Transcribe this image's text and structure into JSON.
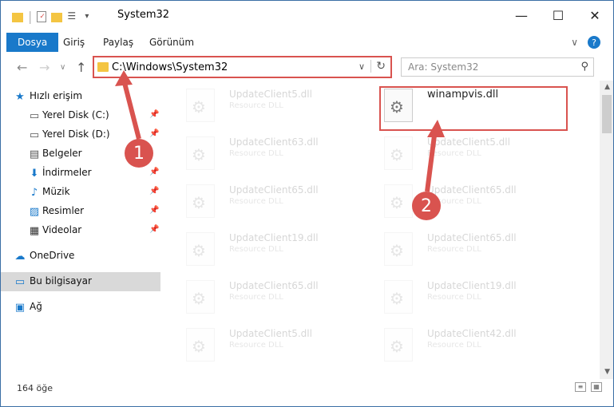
{
  "window": {
    "title": "System32",
    "accent_color": "#1979ca",
    "highlight_color": "#d9534f"
  },
  "ribbon": {
    "tabs": [
      {
        "label": "Dosya",
        "active": true
      },
      {
        "label": "Giriş",
        "active": false
      },
      {
        "label": "Paylaş",
        "active": false
      },
      {
        "label": "Görünüm",
        "active": false
      }
    ]
  },
  "address": {
    "path": "C:\\Windows\\System32",
    "search_placeholder": "Ara: System32"
  },
  "sidebar": {
    "quick_access_label": "Hızlı erişim",
    "items": [
      {
        "label": "Yerel Disk (C:)",
        "icon": "drive-icon",
        "pinned": true
      },
      {
        "label": "Yerel Disk (D:)",
        "icon": "drive-icon",
        "pinned": true
      },
      {
        "label": "Belgeler",
        "icon": "documents-icon",
        "pinned": true
      },
      {
        "label": "İndirmeler",
        "icon": "download-icon",
        "pinned": true
      },
      {
        "label": "Müzik",
        "icon": "music-icon",
        "pinned": true
      },
      {
        "label": "Resimler",
        "icon": "pictures-icon",
        "pinned": true
      },
      {
        "label": "Videolar",
        "icon": "video-icon",
        "pinned": true
      }
    ],
    "onedrive_label": "OneDrive",
    "this_pc_label": "Bu bilgisayar",
    "network_label": "Ağ"
  },
  "files": {
    "left_column": [
      {
        "name": "UpdateClient5.dll",
        "desc": "Resource DLL"
      },
      {
        "name": "UpdateClient63.dll",
        "desc": "Resource DLL"
      },
      {
        "name": "UpdateClient65.dll",
        "desc": "Resource DLL"
      },
      {
        "name": "UpdateClient19.dll",
        "desc": "Resource DLL"
      },
      {
        "name": "UpdateClient65.dll",
        "desc": "Resource DLL"
      },
      {
        "name": "UpdateClient5.dll",
        "desc": "Resource DLL"
      }
    ],
    "right_column": [
      {
        "name": "winampvis.dll",
        "desc": ""
      },
      {
        "name": "UpdateClient5.dll",
        "desc": "Resource DLL"
      },
      {
        "name": "UpdateClient65.dll",
        "desc": "Resource DLL"
      },
      {
        "name": "UpdateClient65.dll",
        "desc": "Resource DLL"
      },
      {
        "name": "UpdateClient19.dll",
        "desc": "Resource DLL"
      },
      {
        "name": "UpdateClient42.dll",
        "desc": "Resource DLL"
      }
    ]
  },
  "status": {
    "item_count": "164 öğe"
  },
  "annotations": {
    "badge1": "1",
    "badge2": "2"
  }
}
